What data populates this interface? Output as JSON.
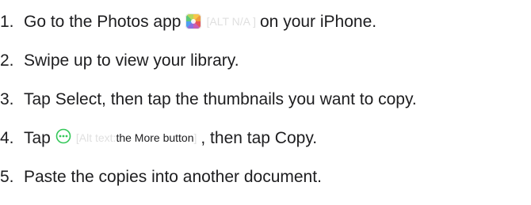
{
  "steps": [
    {
      "number": "1.",
      "before": "Go to the Photos app",
      "alt": "[ALT N/A ]",
      "after": "on your iPhone."
    },
    {
      "number": "2.",
      "text": "Swipe up to view your library."
    },
    {
      "number": "3.",
      "text": "Tap Select, then tap the thumbnails you want to copy."
    },
    {
      "number": "4.",
      "before": "Tap",
      "alt_prefix": "[Alt text: ",
      "alt_inner": "the More button",
      "alt_suffix": "]",
      "after": ", then tap Copy."
    },
    {
      "number": "5.",
      "text": "Paste the copies into another document."
    }
  ],
  "icons": {
    "photos": "photos-app-icon",
    "more": "more-button-icon"
  },
  "colors": {
    "text": "#1d1d1f",
    "faded": "#e0e0e0",
    "more_icon": "#34c759"
  }
}
